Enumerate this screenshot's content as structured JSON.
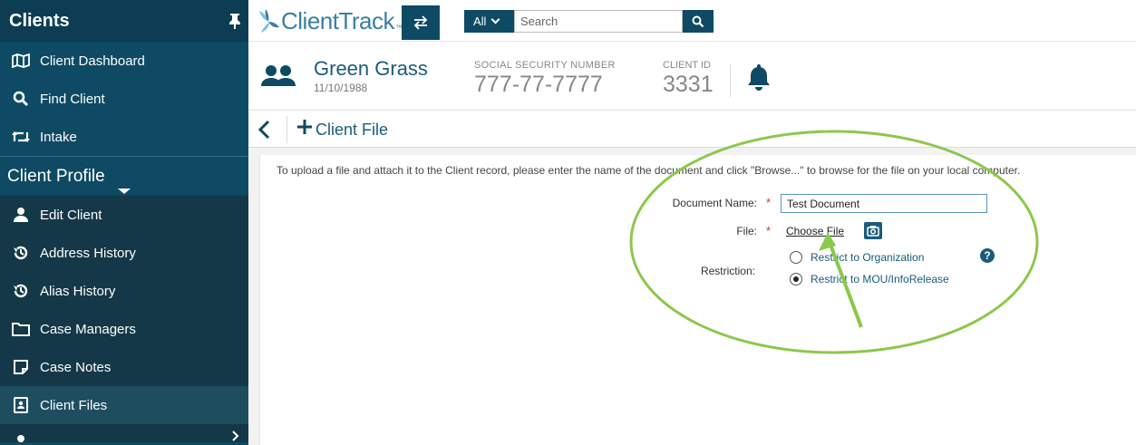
{
  "sidebar": {
    "title": "Clients",
    "top_items": [
      {
        "label": "Client Dashboard",
        "icon": "map-icon"
      },
      {
        "label": "Find Client",
        "icon": "search-icon"
      },
      {
        "label": "Intake",
        "icon": "retweet-icon"
      }
    ],
    "section_title": "Client Profile",
    "profile_items": [
      {
        "label": "Edit Client",
        "icon": "user-icon"
      },
      {
        "label": "Address History",
        "icon": "history-icon"
      },
      {
        "label": "Alias History",
        "icon": "history-icon"
      },
      {
        "label": "Case Managers",
        "icon": "folder-icon"
      },
      {
        "label": "Case Notes",
        "icon": "note-icon"
      },
      {
        "label": "Client Files",
        "icon": "file-icon"
      }
    ]
  },
  "topbar": {
    "logo": "ClientTrack",
    "logo_tm": "™",
    "search_scope": "All",
    "search_placeholder": "Search"
  },
  "client": {
    "name": "Green Grass",
    "dob": "11/10/1988",
    "ssn_label": "SOCIAL SECURITY NUMBER",
    "ssn": "777-77-7777",
    "id_label": "CLIENT ID",
    "id": "3331"
  },
  "toolbar": {
    "title": "Client File"
  },
  "form": {
    "instructions": "To upload a file and attach it to the Client record, please enter the name of the document and click \"Browse...\" to browse for the file on your local computer.",
    "doc_name_label": "Document Name:",
    "doc_name_value": "Test Document",
    "file_label": "File:",
    "choose_file": "Choose File",
    "restriction_label": "Restriction:",
    "restriction_options": [
      {
        "label": "Restrict to Organization",
        "checked": false
      },
      {
        "label": "Restrict to MOU/InfoRelease",
        "checked": true
      }
    ],
    "help": "?"
  },
  "colors": {
    "sidebar_bg": "#0e4a63",
    "accent": "#1a5c7a",
    "annotation": "#8cc84b"
  }
}
